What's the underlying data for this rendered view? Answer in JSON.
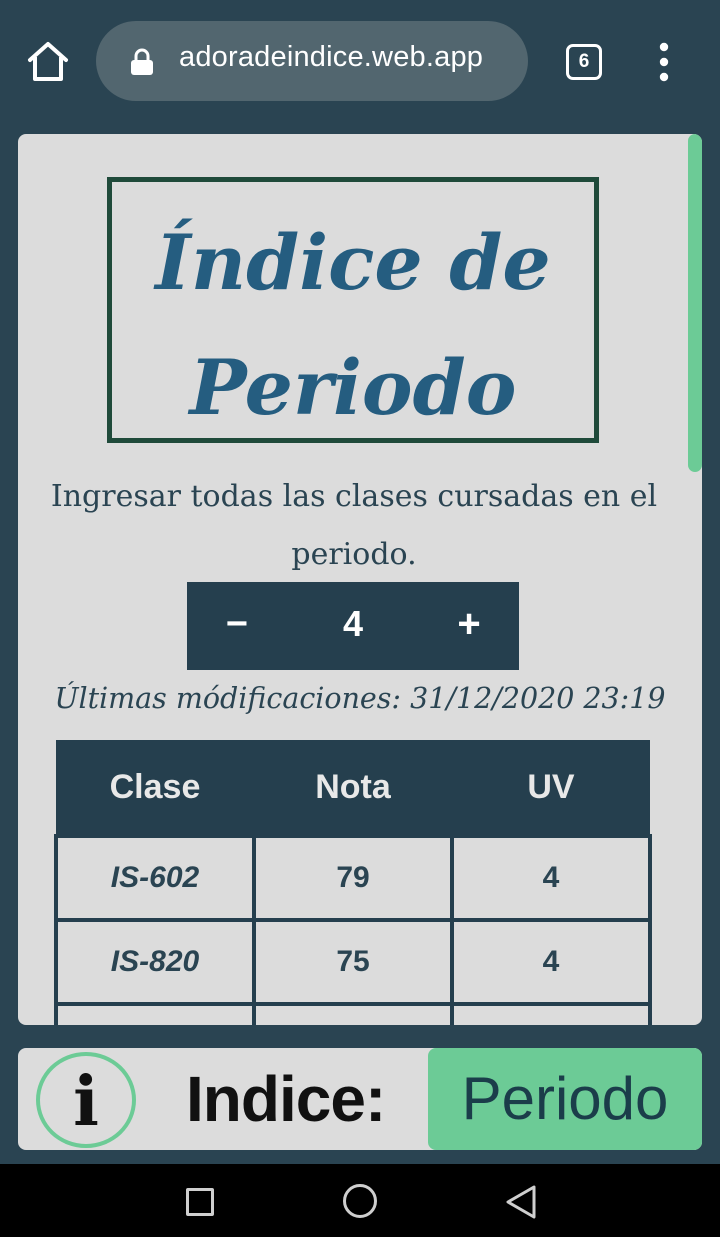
{
  "browser": {
    "url": "adoradeindice.web.app",
    "tab_count": "6",
    "icons": [
      "home-icon",
      "lock-icon",
      "tabs-icon",
      "more-vertical-icon"
    ]
  },
  "page": {
    "title": "Índice de Periodo",
    "description": "Ingresar todas las clases cursadas en el periodo.",
    "stepper": {
      "minus": "−",
      "count": "4",
      "plus": "+"
    },
    "last_modified": "Últimas módificaciones: 31/12/2020 23:19",
    "table": {
      "headers": [
        "Clase",
        "Nota",
        "UV"
      ],
      "rows": [
        [
          "IS-602",
          "79",
          "4"
        ],
        [
          "IS-820",
          "75",
          "4"
        ],
        [
          "",
          "",
          ""
        ]
      ]
    }
  },
  "bottom_bar": {
    "info_glyph": "i",
    "indice_label": "Indice:",
    "periodo_button": "Periodo"
  },
  "colors": {
    "primary": "#253f4e",
    "accent": "#6ccb96",
    "title": "#255d80",
    "background": "#dcdcdc"
  }
}
